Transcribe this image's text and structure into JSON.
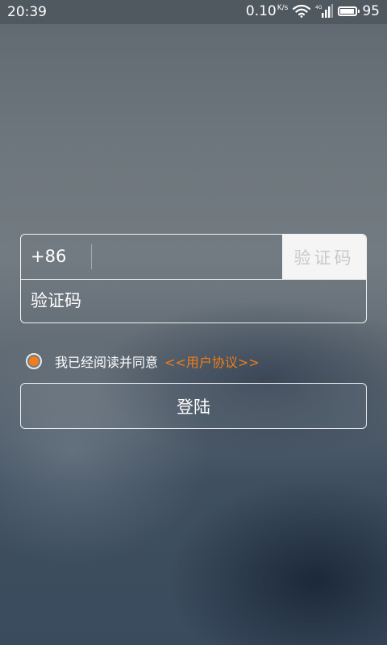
{
  "status_bar": {
    "time": "20:39",
    "network_speed": "0.10",
    "network_speed_unit": "K/s",
    "network_type": "4G",
    "battery_level": "95",
    "battery_fraction": 0.95
  },
  "login_form": {
    "country_code": "+86",
    "phone_value": "",
    "get_code_label": "验证码",
    "code_placeholder": "验证码",
    "code_value": ""
  },
  "agreement": {
    "checked": true,
    "text": "我已经阅读并同意",
    "link_label": "<<用户协议>>",
    "accent_color": "#f07d1c"
  },
  "login_button": {
    "label": "登陆"
  },
  "icons": {
    "wifi": "wifi-icon",
    "signal": "signal-icon",
    "battery": "battery-icon",
    "radio": "radio-checked-icon"
  }
}
